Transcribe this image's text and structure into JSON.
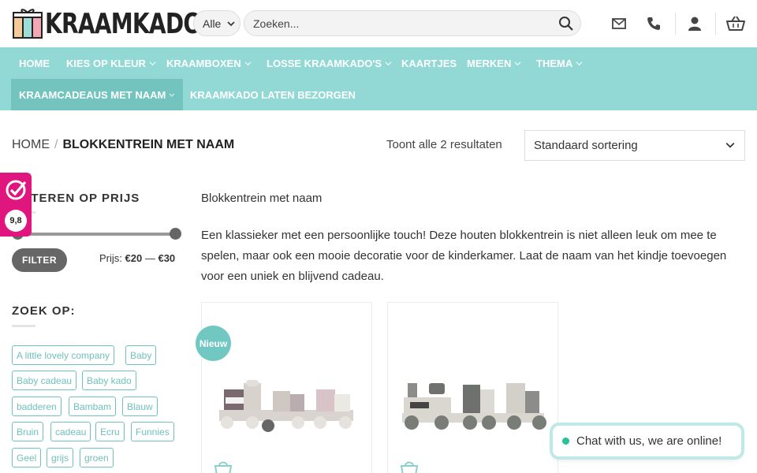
{
  "header": {
    "logo_text": "KRAAMKADO",
    "category_select": "Alle",
    "search_placeholder": "Zoeken..."
  },
  "nav": {
    "items": [
      {
        "label": "Home",
        "dropdown": false
      },
      {
        "label": "Kies op kleur",
        "dropdown": true
      },
      {
        "label": "Kraamboxen",
        "dropdown": true
      },
      {
        "label": "Losse kraamkado's",
        "dropdown": true
      },
      {
        "label": "Kaartjes",
        "dropdown": false
      },
      {
        "label": "Merken",
        "dropdown": true
      },
      {
        "label": "Thema",
        "dropdown": true
      },
      {
        "label": "Kraamcadeaus met naam",
        "dropdown": true,
        "active": true
      },
      {
        "label": "Kraamkado laten bezorgen",
        "dropdown": false
      }
    ]
  },
  "breadcrumb": {
    "home": "HOME",
    "separator": "/",
    "current": "BLOKKENTREIN MET NAAM"
  },
  "results_text": "Toont alle 2 resultaten",
  "sort": {
    "selected": "Standaard sortering"
  },
  "rating": {
    "value": "9,8"
  },
  "sidebar": {
    "price_filter_title": "Filteren op prijs",
    "price_min": 0.0,
    "price_max": 1.0,
    "filter_button": "FILTER",
    "price_prefix": "Prijs:",
    "price_from": "€20",
    "price_dash": "—",
    "price_to": "€30",
    "tags_title": "Zoek op:",
    "tags": [
      "A little lovely company",
      "Baby",
      "Baby cadeau",
      "Baby kado",
      "badderen",
      "Bambam",
      "Blauw",
      "Bruin",
      "cadeau",
      "Ecru",
      "Funnies",
      "Geel",
      "grijs",
      "groen"
    ]
  },
  "category": {
    "title": "Blokkentrein met naam",
    "description": "Een klassieker met een persoonlijke touch! Deze houten blokkentrein is niet alleen leuk om mee te spelen, maar ook een mooie decoratie voor de kinderkamer. Laat de naam van het kindje toevoegen voor een uniek en blijvend cadeau."
  },
  "products": [
    {
      "badge": "Nieuw"
    },
    {
      "badge": ""
    }
  ],
  "chat": {
    "label": "Chat with us, we are online!"
  },
  "colors": {
    "nav_bg": "#92d9d5",
    "nav_active": "#73c4bf",
    "tag_border": "#71c1bb",
    "rating_bg": "#e0157d",
    "badge_new": "#71c8c2"
  }
}
